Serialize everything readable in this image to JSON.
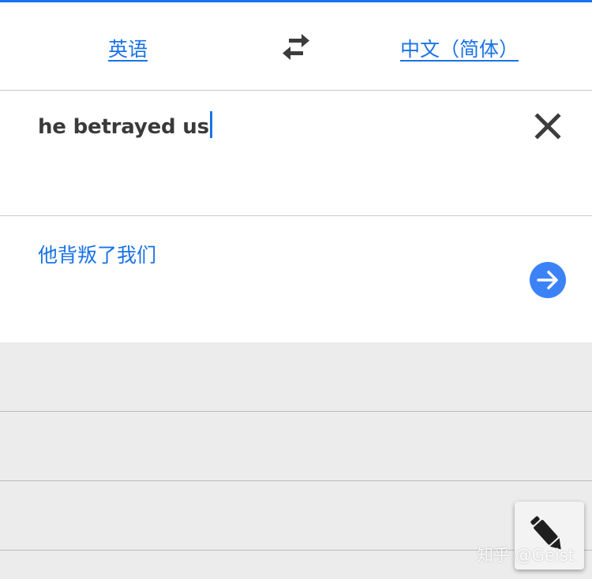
{
  "languages": {
    "source": "英语",
    "target": "中文（简体）"
  },
  "input": {
    "text": "he betrayed us"
  },
  "output": {
    "translation": "他背叛了我们"
  },
  "icons": {
    "swap": "swap-arrows-icon",
    "clear": "close-icon",
    "submit": "arrow-right-icon",
    "handwriting": "pen-icon"
  },
  "colors": {
    "accent": "#1a73e8",
    "submit_button": "#3b82f6",
    "list_background": "#ececec"
  },
  "watermark": "知乎 @Geist"
}
